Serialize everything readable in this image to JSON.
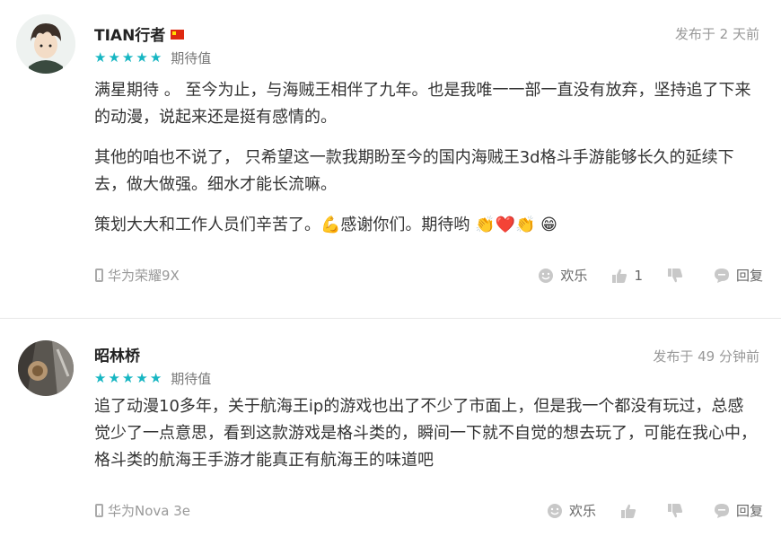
{
  "reviews": [
    {
      "username": "TIAN行者",
      "time": "发布于 2 天前",
      "rating_label": "期待值",
      "stars": 5,
      "paragraphs": [
        "满星期待 。 至今为止，与海贼王相伴了九年。也是我唯一一部一直没有放弃，坚持追了下来的动漫，说起来还是挺有感情的。",
        "其他的咱也不说了， 只希望这一款我期盼至今的国内海贼王3d格斗手游能够长久的延续下去，做大做强。细水才能长流嘛。",
        "策划大大和工作人员们辛苦了。💪感谢你们。期待哟 👏❤️👏 😁"
      ],
      "device": "华为荣耀9X",
      "actions": {
        "fun": "欢乐",
        "like_count": "1",
        "reply": "回复"
      }
    },
    {
      "username": "昭林桥",
      "time": "发布于 49 分钟前",
      "rating_label": "期待值",
      "stars": 5,
      "paragraphs": [
        "追了动漫10多年，关于航海王ip的游戏也出了不少了市面上，但是我一个都没有玩过，总感觉少了一点意思，看到这款游戏是格斗类的，瞬间一下就不自觉的想去玩了，可能在我心中，格斗类的航海王手游才能真正有航海王的味道吧"
      ],
      "device": "华为Nova 3e",
      "actions": {
        "fun": "欢乐",
        "like_count": "",
        "reply": "回复"
      }
    }
  ],
  "colors": {
    "star": "#16b6c2",
    "muted": "#999999",
    "text": "#333333"
  }
}
